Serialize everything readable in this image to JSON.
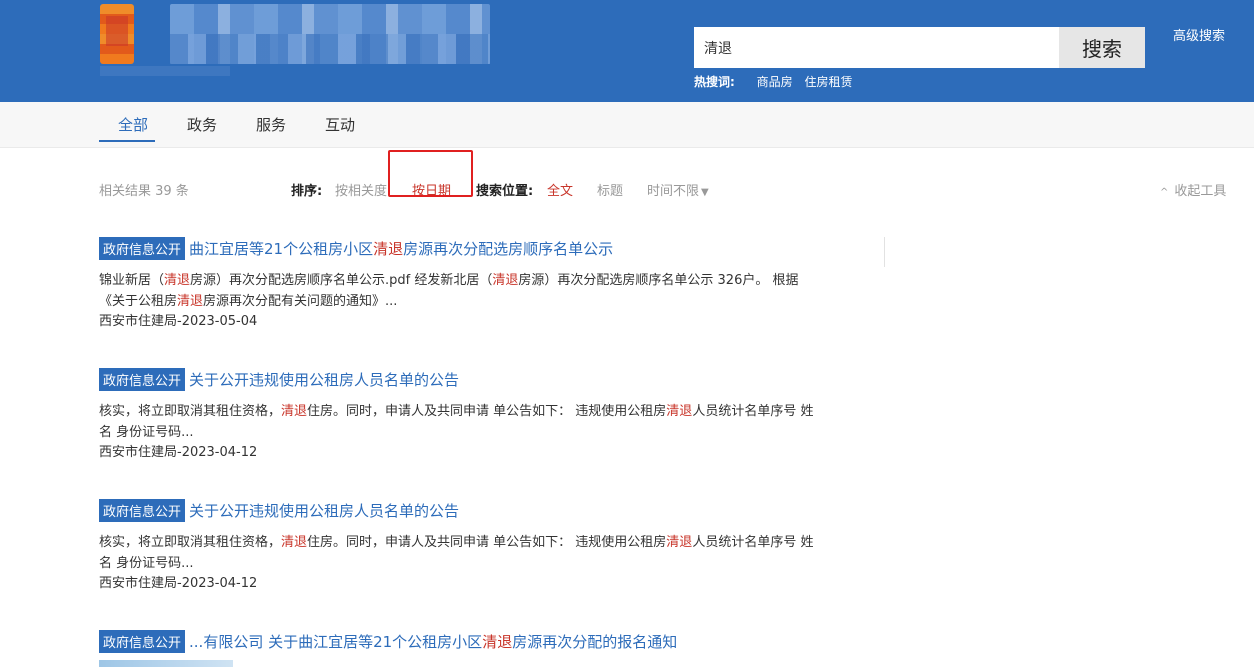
{
  "header": {
    "search_value": "清退",
    "search_button": "搜索",
    "hot_label": "热搜词:",
    "hot_words": [
      "商品房",
      "住房租赁"
    ],
    "advanced_search": "高级搜索"
  },
  "nav": {
    "tabs": [
      {
        "label": "全部",
        "active": true
      },
      {
        "label": "政务"
      },
      {
        "label": "服务"
      },
      {
        "label": "互动"
      }
    ]
  },
  "toolbar": {
    "result_count": "相关结果 39 条",
    "sort_label": "排序:",
    "sort_relevance": "按相关度",
    "sort_date": "按日期",
    "position_label": "搜索位置:",
    "position_full": "全文",
    "position_title": "标题",
    "time_filter": "时间不限",
    "collapse_tools": "收起工具"
  },
  "results": [
    {
      "badge": "政府信息公开",
      "title_parts": [
        "曲江宜居等21个公租房小区",
        "清退",
        "房源再次分配选房顺序名单公示"
      ],
      "snippet_parts": [
        "锦业新居（",
        "清退",
        "房源）再次分配选房顺序名单公示.pdf 经发新北居（",
        "清退",
        "房源）再次分配选房顺序名单公示 326户。 根据《关于公租房",
        "清退",
        "房源再次分配有关问题的通知》..."
      ],
      "meta": "西安市住建局-2023-05-04"
    },
    {
      "badge": "政府信息公开",
      "title_parts": [
        "关于公开违规使用公租房人员名单的公告"
      ],
      "snippet_parts": [
        "核实，将立即取消其租住资格，",
        "清退",
        "住房。同时，申请人及共同申请 单公告如下： 违规使用公租房",
        "清退",
        "人员统计名单序号 姓名 身份证号码..."
      ],
      "meta": "西安市住建局-2023-04-12"
    },
    {
      "badge": "政府信息公开",
      "title_parts": [
        "关于公开违规使用公租房人员名单的公告"
      ],
      "snippet_parts": [
        "核实，将立即取消其租住资格，",
        "清退",
        "住房。同时，申请人及共同申请 单公告如下： 违规使用公租房",
        "清退",
        "人员统计名单序号 姓名 身份证号码..."
      ],
      "meta": "西安市住建局-2023-04-12"
    },
    {
      "badge": "政府信息公开",
      "title_parts": [
        "...有限公司 关于曲江宜居等21个公租房小区",
        "清退",
        "房源再次分配的报名通知"
      ],
      "snippet_parts": [],
      "meta": ""
    }
  ],
  "colors": {
    "header_blue": "#2d6cba",
    "keyword_red": "#c8352a",
    "highlight_box": "#e02020"
  },
  "icons": {
    "time_filter": "caret-down-icon",
    "collapse": "chevron-up-icon"
  }
}
